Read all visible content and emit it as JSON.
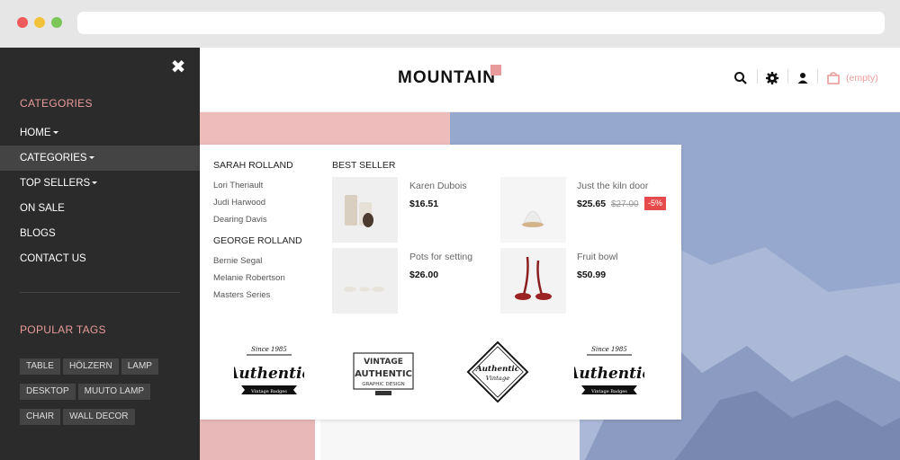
{
  "drawer": {
    "categories_title": "CATEGORIES",
    "nav": [
      "HOME",
      "CATEGORIES",
      "TOP SELLERS",
      "ON SALE",
      "BLOGS",
      "CONTACT US"
    ],
    "popular_tags_title": "POPULAR TAGS",
    "tags": [
      "TABLE",
      "HÖLZERN",
      "LAMP",
      "DESKTOP",
      "MUUTO LAMP",
      "CHAIR",
      "WALL DECOR"
    ]
  },
  "header": {
    "logo": "MOUNTAIN",
    "cart_label": "(empty)",
    "icons": [
      "search-icon",
      "gear-icon",
      "user-icon",
      "cart-icon"
    ]
  },
  "mega": {
    "col1_title": "SARAH ROLLAND",
    "col1_links": [
      "Lori Theriault",
      "Judi Harwood",
      "Dearing Davis"
    ],
    "col2_title": "GEORGE ROLLAND",
    "col2_links": [
      "Bernie Segal",
      "Melanie Robertson",
      "Masters Series"
    ],
    "best_seller_title": "BEST SELLER",
    "products": [
      {
        "name": "Karen Dubois",
        "price": "$16.51"
      },
      {
        "name": "Just the kiln door",
        "price": "$25.65",
        "old_price": "$27.00",
        "discount": "-5%"
      },
      {
        "name": "Pots for setting",
        "price": "$26.00"
      },
      {
        "name": "Fruit bowl",
        "price": "$50.99"
      }
    ],
    "badges": [
      {
        "top": "Since 1985",
        "main": "Authentic",
        "bottom": "Vintage Badges"
      },
      {
        "top": "VINTAGE",
        "main": "AUTHENTIC",
        "bottom": "GRAPHIC DESIGN"
      },
      {
        "top": "",
        "main": "Authentic",
        "bottom": "Vintage"
      },
      {
        "top": "Since 1985",
        "main": "Authentic",
        "bottom": "Vintage Badges"
      }
    ]
  },
  "colors": {
    "accent_pink": "#e99b9b",
    "drawer_bg": "#2b2b2b",
    "hero_blue": "#97a8cf",
    "discount_red": "#e54b4b"
  }
}
